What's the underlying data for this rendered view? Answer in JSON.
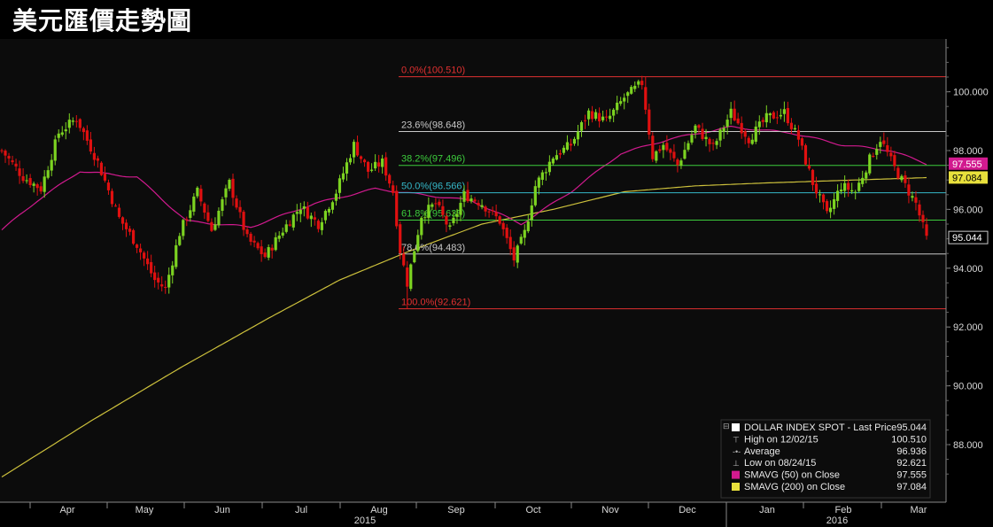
{
  "title": "美元匯價走勢圖",
  "colors": {
    "background": "#000000",
    "plot_bg": "#0c0c0c",
    "up_candle": "#7cd321",
    "down_candle": "#e01010",
    "sma50": "#d21a8f",
    "sma200": "#cdc13c",
    "fib_0": "#e03030",
    "fib_236": "#c8c8c8",
    "fib_382": "#3ccc3c",
    "fib_50": "#35b8c8",
    "fib_618": "#3ccc3c",
    "fib_786": "#c8c8c8",
    "fib_100": "#e03030"
  },
  "chart_data": {
    "type": "candlestick",
    "ylim": [
      86.5,
      101.6
    ],
    "y_ticks": [
      "88.000",
      "90.000",
      "92.000",
      "94.000",
      "96.000",
      "98.000",
      "100.000"
    ],
    "x_months": [
      "Apr",
      "May",
      "Jun",
      "Jul",
      "Aug",
      "Sep",
      "Oct",
      "Nov",
      "Dec",
      "Jan",
      "Feb",
      "Mar"
    ],
    "x_years": [
      "2015",
      "2016"
    ],
    "fib_levels": [
      {
        "label": "0.0%(100.510)",
        "value": 100.51,
        "color": "#e03030"
      },
      {
        "label": "23.6%(98.648)",
        "value": 98.648,
        "color": "#c8c8c8"
      },
      {
        "label": "38.2%(97.496)",
        "value": 97.496,
        "color": "#3ccc3c"
      },
      {
        "label": "50.0%(96.566)",
        "value": 96.566,
        "color": "#35b8c8"
      },
      {
        "label": "61.8%(95.635)",
        "value": 95.635,
        "color": "#3ccc3c"
      },
      {
        "label": "78.6%(94.483)",
        "value": 94.483,
        "color": "#c8c8c8"
      },
      {
        "label": "100.0%(92.621)",
        "value": 92.621,
        "color": "#e03030"
      }
    ],
    "price_tags": [
      {
        "label": "97.555",
        "value": 97.555,
        "bg": "#d21a8f",
        "fg": "#ffffff"
      },
      {
        "label": "97.084",
        "value": 97.084,
        "bg": "#e8e03c",
        "fg": "#000000"
      },
      {
        "label": "95.044",
        "value": 95.044,
        "bg": "#000000",
        "fg": "#ffffff"
      }
    ],
    "close_anchors": [
      [
        0,
        98.0
      ],
      [
        6,
        97.1
      ],
      [
        11,
        96.7
      ],
      [
        16,
        98.6
      ],
      [
        21,
        99.1
      ],
      [
        27,
        97.6
      ],
      [
        33,
        95.7
      ],
      [
        38,
        94.8
      ],
      [
        43,
        93.6
      ],
      [
        46,
        93.3
      ],
      [
        50,
        95.2
      ],
      [
        55,
        96.6
      ],
      [
        59,
        95.3
      ],
      [
        64,
        96.9
      ],
      [
        69,
        95.0
      ],
      [
        74,
        94.4
      ],
      [
        79,
        95.3
      ],
      [
        84,
        96.1
      ],
      [
        89,
        95.5
      ],
      [
        94,
        96.6
      ],
      [
        99,
        98.2
      ],
      [
        103,
        97.3
      ],
      [
        107,
        97.6
      ],
      [
        110,
        96.6
      ],
      [
        112,
        94.6
      ],
      [
        114,
        93.5
      ],
      [
        118,
        95.8
      ],
      [
        122,
        96.2
      ],
      [
        126,
        95.3
      ],
      [
        130,
        96.5
      ],
      [
        135,
        96.2
      ],
      [
        140,
        95.6
      ],
      [
        144,
        94.3
      ],
      [
        147,
        95.2
      ],
      [
        150,
        96.8
      ],
      [
        155,
        97.8
      ],
      [
        160,
        98.2
      ],
      [
        165,
        99.3
      ],
      [
        170,
        99.0
      ],
      [
        175,
        99.8
      ],
      [
        180,
        100.3
      ],
      [
        183,
        97.8
      ],
      [
        186,
        98.2
      ],
      [
        190,
        97.5
      ],
      [
        195,
        98.8
      ],
      [
        200,
        98.1
      ],
      [
        205,
        99.3
      ],
      [
        210,
        98.4
      ],
      [
        215,
        99.1
      ],
      [
        220,
        99.3
      ],
      [
        224,
        98.4
      ],
      [
        228,
        96.9
      ],
      [
        232,
        95.8
      ],
      [
        236,
        96.8
      ],
      [
        240,
        96.6
      ],
      [
        244,
        97.7
      ],
      [
        247,
        98.4
      ],
      [
        251,
        97.4
      ],
      [
        254,
        96.8
      ],
      [
        257,
        96.2
      ],
      [
        260,
        95.0
      ]
    ],
    "sma50_anchors": [
      [
        0,
        95.3
      ],
      [
        10,
        96.3
      ],
      [
        22,
        97.3
      ],
      [
        38,
        97.1
      ],
      [
        52,
        95.6
      ],
      [
        70,
        95.4
      ],
      [
        88,
        96.2
      ],
      [
        105,
        96.7
      ],
      [
        118,
        96.5
      ],
      [
        132,
        96.3
      ],
      [
        146,
        95.5
      ],
      [
        160,
        96.6
      ],
      [
        174,
        97.9
      ],
      [
        188,
        98.4
      ],
      [
        205,
        98.8
      ],
      [
        222,
        98.6
      ],
      [
        236,
        98.2
      ],
      [
        250,
        98.0
      ],
      [
        260,
        97.55
      ]
    ],
    "sma200_anchors": [
      [
        0,
        86.9
      ],
      [
        25,
        88.8
      ],
      [
        50,
        90.6
      ],
      [
        75,
        92.3
      ],
      [
        95,
        93.6
      ],
      [
        115,
        94.6
      ],
      [
        135,
        95.5
      ],
      [
        155,
        96.0
      ],
      [
        175,
        96.6
      ],
      [
        195,
        96.8
      ],
      [
        215,
        96.9
      ],
      [
        240,
        97.0
      ],
      [
        260,
        97.08
      ]
    ],
    "legend": [
      {
        "marker": "white-square",
        "label": "DOLLAR INDEX SPOT - Last Price",
        "value": "95.044"
      },
      {
        "marker": "high-icon",
        "label": "High on 12/02/15",
        "value": "100.510"
      },
      {
        "marker": "average-icon",
        "label": "Average",
        "value": "96.936"
      },
      {
        "marker": "low-icon",
        "label": "Low on 08/24/15",
        "value": "92.621"
      },
      {
        "marker": "magenta-square",
        "label": "SMAVG (50) on Close",
        "value": "97.555"
      },
      {
        "marker": "yellow-square",
        "label": "SMAVG (200) on Close",
        "value": "97.084"
      }
    ]
  }
}
